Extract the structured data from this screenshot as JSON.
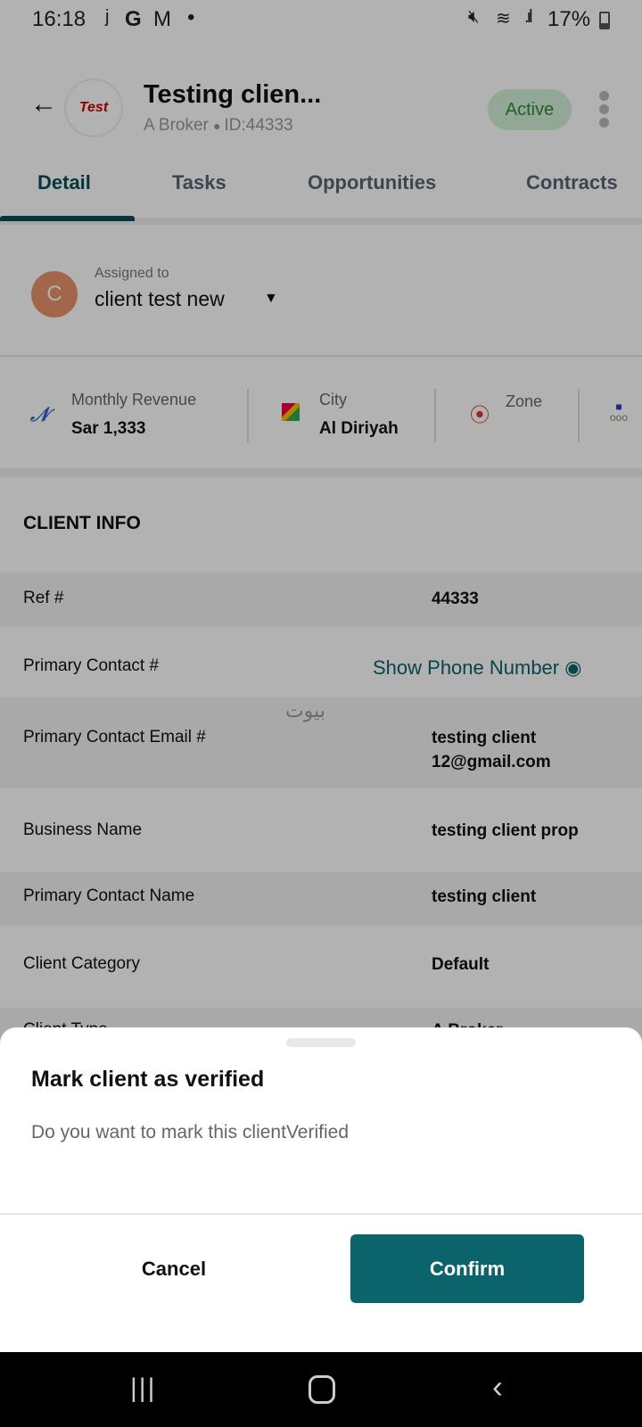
{
  "status_bar": {
    "time": "16:18",
    "notif_icons": [
      "j",
      "G",
      "M",
      "•"
    ],
    "battery": "17%"
  },
  "header": {
    "title": "Testing clien...",
    "subtitle_type": "A Broker",
    "subtitle_id": "ID:44333",
    "status": "Active",
    "logo_text": "Test"
  },
  "tabs": [
    {
      "label": "Detail",
      "active": true
    },
    {
      "label": "Tasks"
    },
    {
      "label": "Opportunities"
    },
    {
      "label": "Contracts"
    }
  ],
  "assigned": {
    "label": "Assigned to",
    "avatar": "C",
    "value": "client test new"
  },
  "stats": [
    {
      "label": "Monthly Revenue",
      "value": "Sar 1,333",
      "icon": "trend-line-icon"
    },
    {
      "label": "City",
      "value": "Al Diriyah",
      "icon": "map-icon"
    },
    {
      "label": "Zone",
      "value": "",
      "icon": "location-pin-icon"
    },
    {
      "icon": "hierarchy-icon"
    }
  ],
  "client_info": {
    "title": "CLIENT INFO",
    "rows": [
      {
        "key": "Ref #",
        "value": "44333"
      },
      {
        "key": "Primary Contact #",
        "value": "Show Phone Number"
      },
      {
        "key": "Primary Contact Email #",
        "value": "testing client\n12@gmail.com"
      },
      {
        "key": "Business Name",
        "value": "testing client prop"
      },
      {
        "key": "Primary Contact Name",
        "value": "testing client"
      },
      {
        "key": "Client Category",
        "value": "Default"
      },
      {
        "key": "Client Type",
        "value": "A Broker"
      }
    ]
  },
  "watermark": "بيوت",
  "dialog": {
    "title": "Mark client as verified",
    "message": "Do you want to mark this clientVerified",
    "cancel": "Cancel",
    "confirm": "Confirm"
  },
  "colors": {
    "primary": "#0b636b",
    "active_badge_bg": "#d3f0d8",
    "active_badge_text": "#2e8b3a"
  }
}
